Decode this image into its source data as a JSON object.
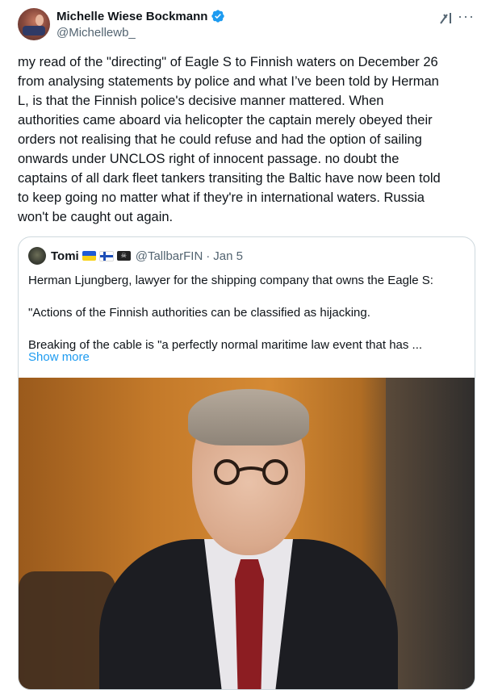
{
  "tweet": {
    "author_name": "Michelle Wiese Bockmann",
    "author_handle": "@Michellewb_",
    "body": "my read of the \"directing\" of Eagle S to Finnish waters on December 26\nfrom analysing statements by police and what I’ve been told by Herman\nL, is that the Finnish police's decisive manner mattered. When\nauthorities came aboard via helicopter the captain merely obeyed their\norders not realising that he could refuse and had the option of sailing\nonwards under UNCLOS right of innocent passage. no doubt the\ncaptains of all dark fleet tankers transiting the Baltic have now been told\nto keep going no matter what if they're in international waters. Russia\nwon't be caught out again.",
    "more_icon_glyph": "···",
    "icons": [
      "avatar",
      "verified-badge-icon",
      "grok-icon",
      "more-icon"
    ]
  },
  "quote": {
    "author_name": "Tomi",
    "author_handle": "@TallbarFIN",
    "separator": "·",
    "date": "Jan 5",
    "flags": [
      "ukraine-flag-icon",
      "finland-flag-icon",
      "pirate-flag-icon"
    ],
    "lines": [
      "Herman Ljungberg, lawyer for the shipping company that owns the Eagle S:",
      "\"Actions of the Finnish authorities can be classified as hijacking.",
      "Breaking of the cable is \"a perfectly normal maritime law event that has ..."
    ],
    "show_more": "Show more"
  },
  "colors": {
    "link": "#1d9bf0",
    "secondary_text": "#536471",
    "border": "#cfd9de",
    "verified": "#1d9bf0"
  }
}
